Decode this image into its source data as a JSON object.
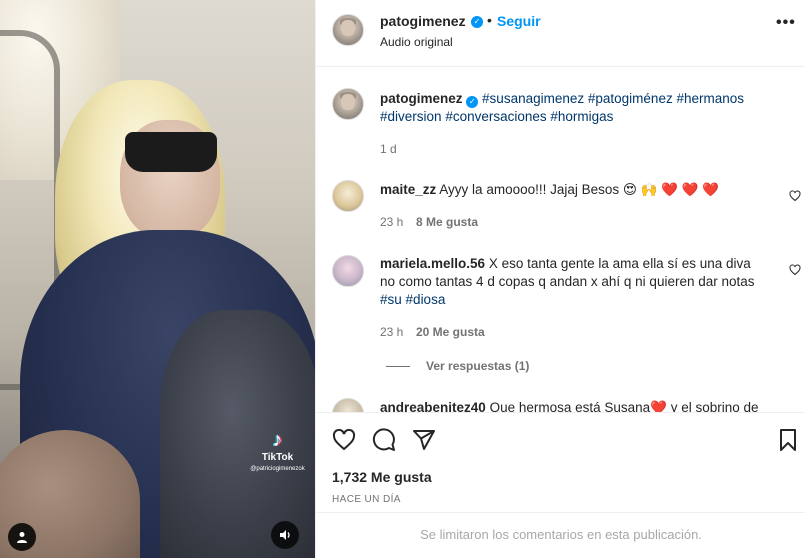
{
  "post": {
    "username": "patogimenez",
    "follow_label": "Seguir",
    "separator": "•",
    "subtitle": "Audio original",
    "more_label": "•••"
  },
  "media": {
    "tiktok_brand": "TikTok",
    "tiktok_mark": "♪",
    "tiktok_handle": "@patriciogimenezok",
    "user_icon": "user-icon",
    "audio_icon": "speaker-icon"
  },
  "caption": {
    "username": "patogimenez",
    "tags": [
      "#susanagimenez",
      "#patogiménez",
      "#hermanos",
      "#diversion",
      "#conversaciones",
      "#hormigas"
    ],
    "time": "1 d"
  },
  "comments": [
    {
      "username": "maite_zz",
      "text": "Ayyy la amoooo!!! Jajaj Besos 😍 🙌 ❤️ ❤️ ❤️",
      "time": "23 h",
      "likes": "8 Me gusta"
    },
    {
      "username": "mariela.mello.56",
      "text_line1": "X eso tanta gente la ama ella sí es una diva",
      "text_line2": "no como tantas 4 d copas q andan x ahí q ni quieren dar notas",
      "tags": [
        "#su",
        "#diosa"
      ],
      "time": "23 h",
      "likes": "20 Me gusta",
      "view_replies": "Ver respuestas (1)"
    },
    {
      "username": "andreabenitez40",
      "text": "Que hermosa está Susana❤️  y el sobrino de"
    }
  ],
  "actions": {
    "icons": [
      "heart-icon",
      "comment-icon",
      "share-icon",
      "bookmark-icon"
    ],
    "likes": "1,732 Me gusta",
    "time_ago": "HACE UN DÍA"
  },
  "footer": {
    "text": "Se limitaron los comentarios en esta publicación."
  },
  "colors": {
    "link": "#0095f6",
    "tag": "#00376b",
    "muted": "#737373"
  }
}
